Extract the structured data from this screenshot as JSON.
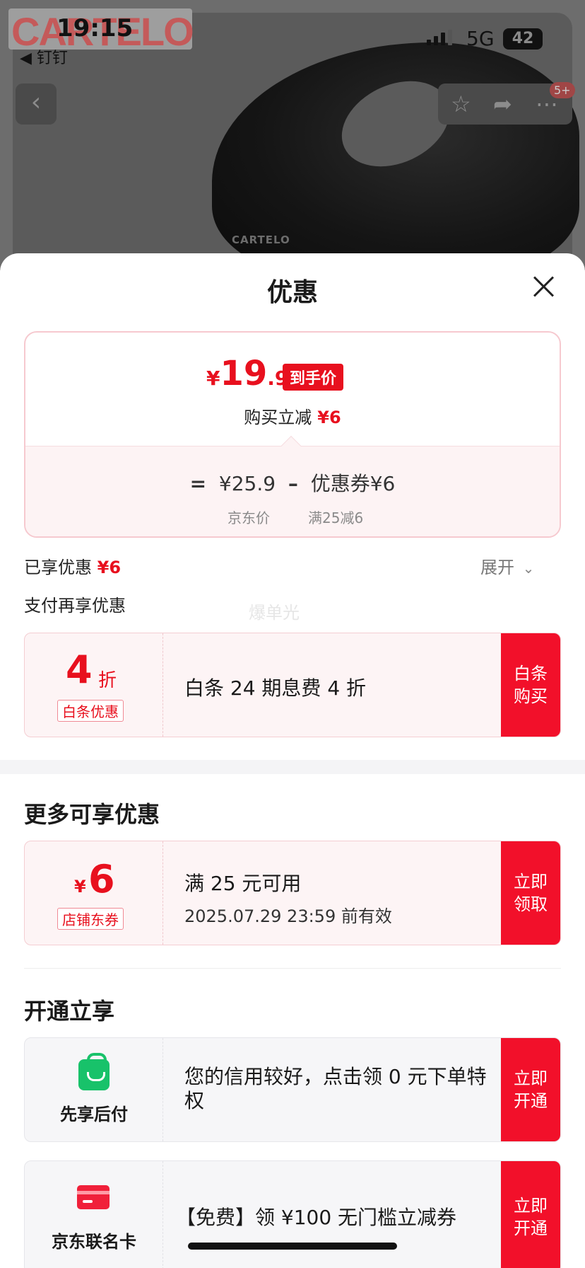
{
  "background": {
    "logo_text": "CARTELO",
    "status": {
      "time": "19:15",
      "back_app": "◀ 钉钉",
      "network": "5G",
      "battery": "42"
    },
    "badge": "5+",
    "shoe_brand": "CARTELO"
  },
  "sheet": {
    "title": "优惠",
    "price": {
      "yen": "¥",
      "int": "19",
      "dec": ".9",
      "tag": "到手价",
      "reduce_label": "购买立减",
      "reduce_value": "¥6",
      "formula": {
        "eq": "=",
        "jd_price": "¥25.9",
        "minus": "–",
        "coupon": "优惠券¥6"
      },
      "jd_price_label": "京东价",
      "coupon_rule": "满25减6"
    },
    "enjoyed_label": "已享优惠",
    "enjoyed_value": "¥6",
    "expand_label": "展开",
    "pay_more_label": "支付再享优惠",
    "watermark": "爆单光",
    "baitiao": {
      "num": "4",
      "unit": "折",
      "tag": "白条优惠",
      "desc": "白条 24 期息费 4 折",
      "action": "白条购买"
    },
    "more_title": "更多可享优惠",
    "coupon": {
      "yen": "¥",
      "num": "6",
      "tag": "店铺东券",
      "line1": "满 25 元可用",
      "line2": "2025.07.29 23:59 前有效",
      "action": "立即领取"
    },
    "open_title": "开通立享",
    "xianxiang": {
      "label": "先享后付",
      "desc": "您的信用较好，点击领 0 元下单特权",
      "action": "立即开通"
    },
    "jdcard": {
      "label": "京东联名卡",
      "desc": "【免费】领 ¥100 无门槛立减券",
      "action": "立即开通"
    }
  },
  "colors": {
    "accent": "#e8101e",
    "action_bg": "#f2102a",
    "success": "#18c26a"
  }
}
